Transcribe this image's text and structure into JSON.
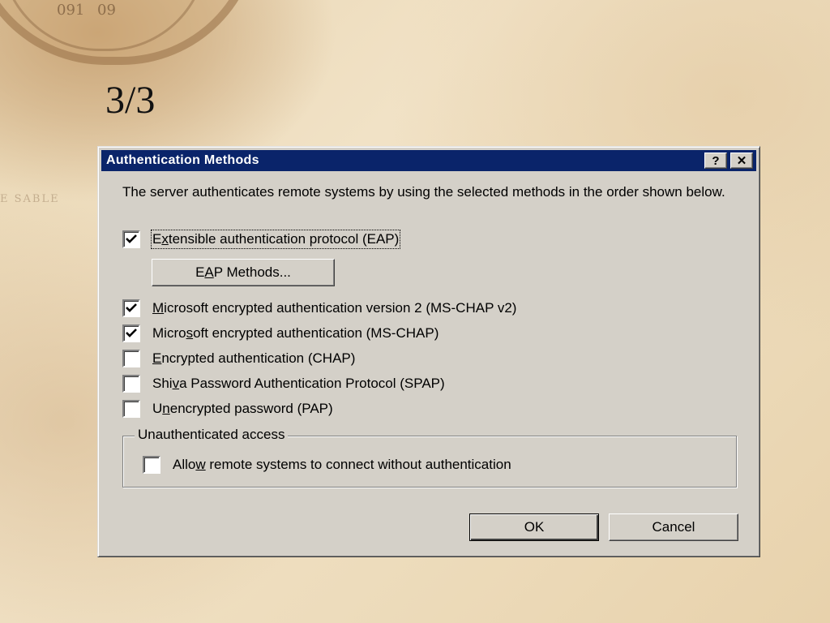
{
  "slide": {
    "title": "3/3",
    "compass_numbers": [
      "091",
      "09"
    ],
    "map_text": "E SABLE"
  },
  "dialog": {
    "title": "Authentication Methods",
    "help_button": "?",
    "close_button": "✕",
    "description": "The server authenticates remote systems by using the selected methods in the order shown below.",
    "options": [
      {
        "pre": "E",
        "mnemonic": "x",
        "post": "tensible authentication protocol (EAP)",
        "checked": true,
        "focused": true
      },
      {
        "pre": "",
        "mnemonic": "M",
        "post": "icrosoft encrypted authentication version 2 (MS-CHAP v2)",
        "checked": true,
        "focused": false
      },
      {
        "pre": "Micro",
        "mnemonic": "s",
        "post": "oft encrypted authentication (MS-CHAP)",
        "checked": true,
        "focused": false
      },
      {
        "pre": "",
        "mnemonic": "E",
        "post": "ncrypted authentication (CHAP)",
        "checked": false,
        "focused": false
      },
      {
        "pre": "Shi",
        "mnemonic": "v",
        "post": "a Password Authentication Protocol (SPAP)",
        "checked": false,
        "focused": false
      },
      {
        "pre": "U",
        "mnemonic": "n",
        "post": "encrypted password (PAP)",
        "checked": false,
        "focused": false
      }
    ],
    "eap_button": {
      "pre": "E",
      "mnemonic": "A",
      "post": "P Methods..."
    },
    "unauth_group": {
      "legend": "Unauthenticated access",
      "option": {
        "pre": "Allo",
        "mnemonic": "w",
        "post": " remote systems to connect without authentication",
        "checked": false
      }
    },
    "ok_label": "OK",
    "cancel_label": "Cancel"
  }
}
